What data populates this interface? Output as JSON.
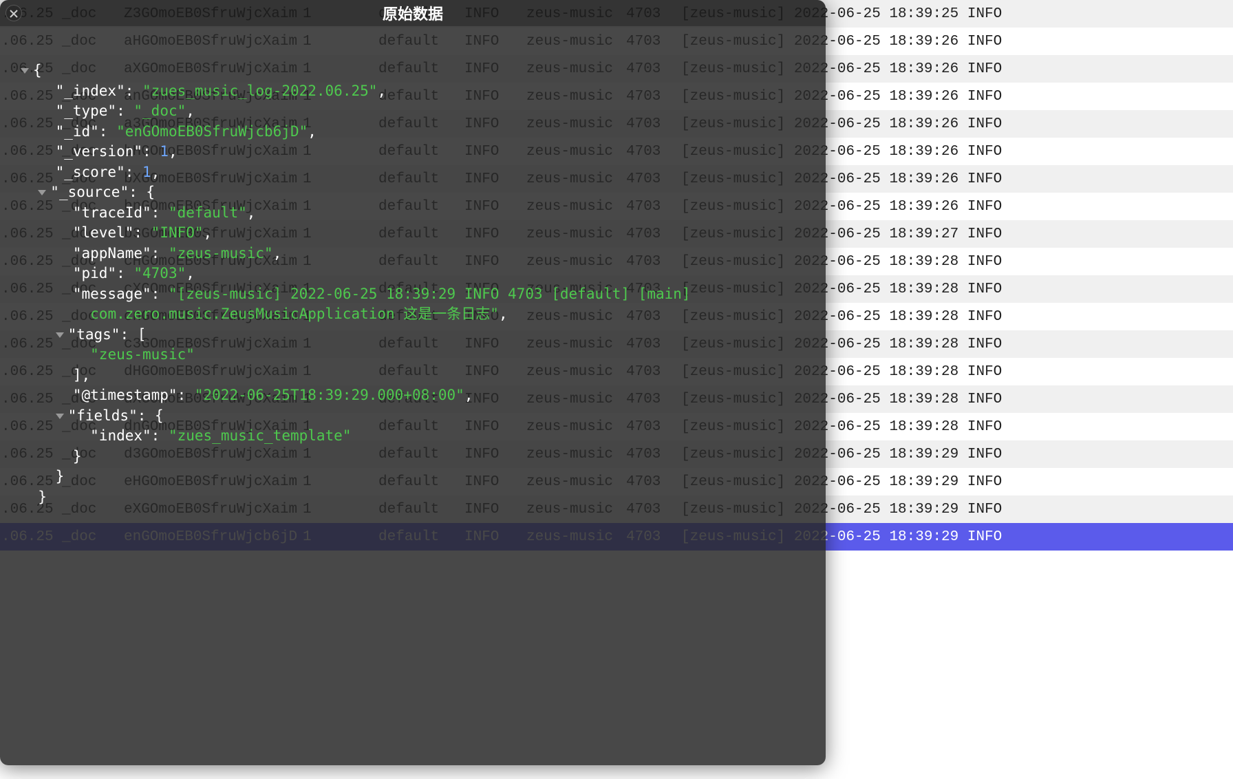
{
  "modal": {
    "title": "原始数据",
    "json": {
      "index_key": "\"_index\"",
      "index_val": "\"zues_music_log-2022.06.25\"",
      "type_key": "\"_type\"",
      "type_val": "\"_doc\"",
      "id_key": "\"_id\"",
      "id_val": "\"enGOmoEB0SfruWjcb6jD\"",
      "version_key": "\"_version\"",
      "version_val": "1",
      "score_key": "\"_score\"",
      "score_val": "1",
      "source_key": "\"_source\"",
      "traceId_key": "\"traceId\"",
      "traceId_val": "\"default\"",
      "level_key": "\"level\"",
      "level_val": "\"INFO\"",
      "appName_key": "\"appName\"",
      "appName_val": "\"zeus-music\"",
      "pid_key": "\"pid\"",
      "pid_val": "\"4703\"",
      "message_key": "\"message\"",
      "message_val_l1": "\"[zeus-music] 2022-06-25 18:39:29 INFO 4703 [default] [main]",
      "message_val_l2": "com.zero.music.ZeusMusicApplication 这是一条日志\"",
      "tags_key": "\"tags\"",
      "tags_val0": "\"zeus-music\"",
      "timestamp_key": "\"@timestamp\"",
      "timestamp_val": "\"2022-06-25T18:39:29.000+08:00\"",
      "fields_key": "\"fields\"",
      "fields_index_key": "\"index\"",
      "fields_index_val": "\"zues_music_template\""
    }
  },
  "table": {
    "rows": [
      {
        "date": ".06.25",
        "type": "_doc",
        "id": "Z3GOmoEB0SfruWjcXaim",
        "ver": "1",
        "trace": "default",
        "level": "INFO",
        "app": "zeus-music",
        "pid": "4703",
        "msg": "[zeus-music] 2022-06-25 18:39:25 INFO"
      },
      {
        "date": ".06.25",
        "type": "_doc",
        "id": "aHGOmoEB0SfruWjcXaim",
        "ver": "1",
        "trace": "default",
        "level": "INFO",
        "app": "zeus-music",
        "pid": "4703",
        "msg": "[zeus-music] 2022-06-25 18:39:26 INFO"
      },
      {
        "date": ".06.25",
        "type": "_doc",
        "id": "aXGOmoEB0SfruWjcXaim",
        "ver": "1",
        "trace": "default",
        "level": "INFO",
        "app": "zeus-music",
        "pid": "4703",
        "msg": "[zeus-music] 2022-06-25 18:39:26 INFO"
      },
      {
        "date": ".06.25",
        "type": "_doc",
        "id": "anGOmoEB0SfruWjcXaim",
        "ver": "1",
        "trace": "default",
        "level": "INFO",
        "app": "zeus-music",
        "pid": "4703",
        "msg": "[zeus-music] 2022-06-25 18:39:26 INFO"
      },
      {
        "date": ".06.25",
        "type": "_doc",
        "id": "a3GOmoEB0SfruWjcXaim",
        "ver": "1",
        "trace": "default",
        "level": "INFO",
        "app": "zeus-music",
        "pid": "4703",
        "msg": "[zeus-music] 2022-06-25 18:39:26 INFO"
      },
      {
        "date": ".06.25",
        "type": "_doc",
        "id": "bHGOmoEB0SfruWjcXaim",
        "ver": "1",
        "trace": "default",
        "level": "INFO",
        "app": "zeus-music",
        "pid": "4703",
        "msg": "[zeus-music] 2022-06-25 18:39:26 INFO"
      },
      {
        "date": ".06.25",
        "type": "_doc",
        "id": "bXGOmoEB0SfruWjcXaim",
        "ver": "1",
        "trace": "default",
        "level": "INFO",
        "app": "zeus-music",
        "pid": "4703",
        "msg": "[zeus-music] 2022-06-25 18:39:26 INFO"
      },
      {
        "date": ".06.25",
        "type": "_doc",
        "id": "bnGOmoEB0SfruWjcXaim",
        "ver": "1",
        "trace": "default",
        "level": "INFO",
        "app": "zeus-music",
        "pid": "4703",
        "msg": "[zeus-music] 2022-06-25 18:39:26 INFO"
      },
      {
        "date": ".06.25",
        "type": "_doc",
        "id": "b3GOmoEB0SfruWjcXaim",
        "ver": "1",
        "trace": "default",
        "level": "INFO",
        "app": "zeus-music",
        "pid": "4703",
        "msg": "[zeus-music] 2022-06-25 18:39:27 INFO"
      },
      {
        "date": ".06.25",
        "type": "_doc",
        "id": "cHGOmoEB0SfruWjcXaim",
        "ver": "1",
        "trace": "default",
        "level": "INFO",
        "app": "zeus-music",
        "pid": "4703",
        "msg": "[zeus-music] 2022-06-25 18:39:28 INFO"
      },
      {
        "date": ".06.25",
        "type": "_doc",
        "id": "cXGOmoEB0SfruWjcXaim",
        "ver": "1",
        "trace": "default",
        "level": "INFO",
        "app": "zeus-music",
        "pid": "4703",
        "msg": "[zeus-music] 2022-06-25 18:39:28 INFO"
      },
      {
        "date": ".06.25",
        "type": "_doc",
        "id": "cnGOmoEB0SfruWjcXaim",
        "ver": "1",
        "trace": "default",
        "level": "INFO",
        "app": "zeus-music",
        "pid": "4703",
        "msg": "[zeus-music] 2022-06-25 18:39:28 INFO"
      },
      {
        "date": ".06.25",
        "type": "_doc",
        "id": "c3GOmoEB0SfruWjcXaim",
        "ver": "1",
        "trace": "default",
        "level": "INFO",
        "app": "zeus-music",
        "pid": "4703",
        "msg": "[zeus-music] 2022-06-25 18:39:28 INFO"
      },
      {
        "date": ".06.25",
        "type": "_doc",
        "id": "dHGOmoEB0SfruWjcXaim",
        "ver": "1",
        "trace": "default",
        "level": "INFO",
        "app": "zeus-music",
        "pid": "4703",
        "msg": "[zeus-music] 2022-06-25 18:39:28 INFO"
      },
      {
        "date": ".06.25",
        "type": "_doc",
        "id": "dXGOmoEB0SfruWjcXaim",
        "ver": "1",
        "trace": "default",
        "level": "INFO",
        "app": "zeus-music",
        "pid": "4703",
        "msg": "[zeus-music] 2022-06-25 18:39:28 INFO"
      },
      {
        "date": ".06.25",
        "type": "_doc",
        "id": "dnGOmoEB0SfruWjcXaim",
        "ver": "1",
        "trace": "default",
        "level": "INFO",
        "app": "zeus-music",
        "pid": "4703",
        "msg": "[zeus-music] 2022-06-25 18:39:28 INFO"
      },
      {
        "date": ".06.25",
        "type": "_doc",
        "id": "d3GOmoEB0SfruWjcXaim",
        "ver": "1",
        "trace": "default",
        "level": "INFO",
        "app": "zeus-music",
        "pid": "4703",
        "msg": "[zeus-music] 2022-06-25 18:39:29 INFO"
      },
      {
        "date": ".06.25",
        "type": "_doc",
        "id": "eHGOmoEB0SfruWjcXaim",
        "ver": "1",
        "trace": "default",
        "level": "INFO",
        "app": "zeus-music",
        "pid": "4703",
        "msg": "[zeus-music] 2022-06-25 18:39:29 INFO"
      },
      {
        "date": ".06.25",
        "type": "_doc",
        "id": "eXGOmoEB0SfruWjcXaim",
        "ver": "1",
        "trace": "default",
        "level": "INFO",
        "app": "zeus-music",
        "pid": "4703",
        "msg": "[zeus-music] 2022-06-25 18:39:29 INFO"
      },
      {
        "date": ".06.25",
        "type": "_doc",
        "id": "enGOmoEB0SfruWjcb6jD",
        "ver": "1",
        "trace": "default",
        "level": "INFO",
        "app": "zeus-music",
        "pid": "4703",
        "msg": "[zeus-music] 2022-06-25 18:39:29 INFO",
        "selected": true
      }
    ]
  }
}
